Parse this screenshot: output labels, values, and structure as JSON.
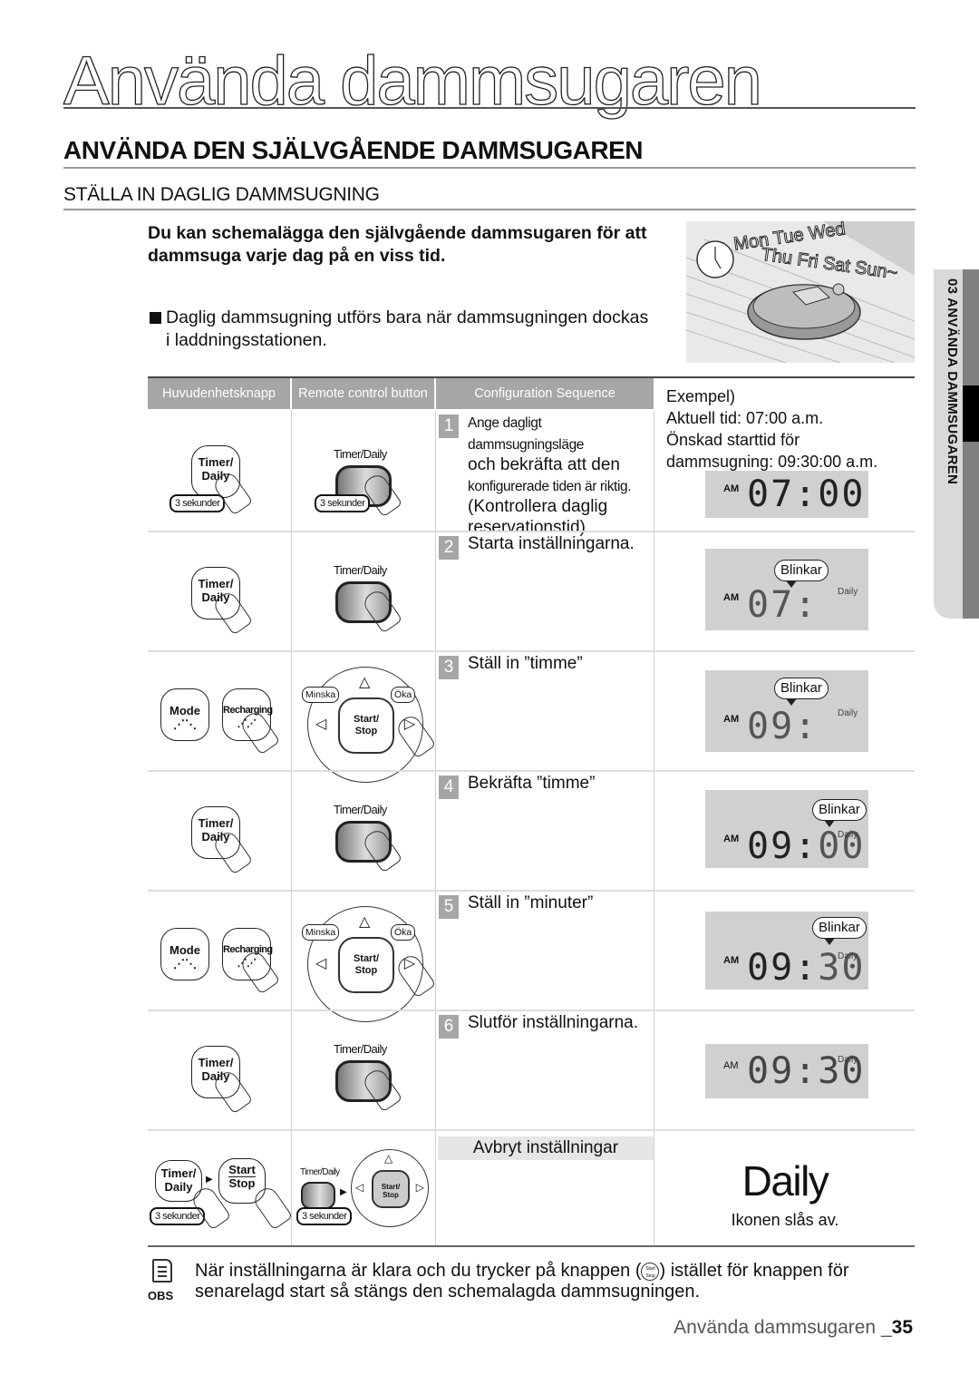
{
  "page": {
    "title": "Använda dammsugaren",
    "section_heading": "ANVÄNDA DEN SJÄLVGÅENDE DAMMSUGAREN",
    "subsection_heading": "STÄLLA IN DAGLIG DAMMSUGNING",
    "intro": "Du kan schemalägga den självgående dammsugaren för att dammsuga varje dag på en viss tid.",
    "bullet": "Daglig dammsugning utförs bara när dammsugningen dockas i laddningsstationen.",
    "side_tab": "03 ANVÄNDA DAMMSUGAREN"
  },
  "illustration": {
    "days_line1": "Mon Tue Wed",
    "days_line2": "Thu Fri Sat Sun~",
    "icons": [
      "alarm-clock",
      "robot-vacuum"
    ]
  },
  "table": {
    "headers": [
      "Huvudenhetsknapp",
      "Remote control button",
      "Configuration Sequence"
    ],
    "example": {
      "label": "Exempel)",
      "current": "Aktuell tid: 07:00 a.m.",
      "desired_1": "Önskad starttid för",
      "desired_2": "dammsugning: 09:30:00 a.m."
    },
    "buttons": {
      "timer_daily_unit_1": "Timer/",
      "timer_daily_unit_2": "Daily",
      "timer_daily_remote": "Timer/Daily",
      "three_seconds": "3 sekunder",
      "mode": "Mode",
      "recharging": "Recharging",
      "start_stop_1": "Start/",
      "start_stop_2": "Stop",
      "start": "Start",
      "stop": "Stop",
      "minska": "Minska",
      "oka": "Öka"
    },
    "steps": [
      {
        "num": "1",
        "text_small": "Ange dagligt dammsugningsläge",
        "text": "och bekräfta att den",
        "text_small2": "konfigurerade tiden är riktig.",
        "text2": "(Kontrollera daglig reservationstid)",
        "lcd": {
          "am": "AM",
          "hh": "07",
          "mm": "00",
          "daily": "",
          "blink": ""
        }
      },
      {
        "num": "2",
        "text": "Starta inställningarna.",
        "lcd": {
          "am": "AM",
          "hh": "07",
          "mm": "",
          "daily": "Daily",
          "blink": "Blinkar"
        }
      },
      {
        "num": "3",
        "text": "Ställ in ”timme”",
        "lcd": {
          "am": "AM",
          "hh": "09",
          "mm": "",
          "daily": "Daily",
          "blink": "Blinkar"
        }
      },
      {
        "num": "4",
        "text": "Bekräfta ”timme”",
        "lcd": {
          "am": "AM",
          "hh": "09",
          "mm": "00",
          "daily": "Daily",
          "blink": "Blinkar"
        }
      },
      {
        "num": "5",
        "text": "Ställ in ”minuter”",
        "lcd": {
          "am": "AM",
          "hh": "09",
          "mm": "30",
          "daily": "Daily",
          "blink": "Blinkar"
        }
      },
      {
        "num": "6",
        "text": "Slutför inställningarna.",
        "lcd": {
          "am": "AM",
          "hh": "09",
          "mm": "30",
          "daily": "Daily",
          "blink": ""
        }
      }
    ],
    "cancel": {
      "heading": "Avbryt inställningar",
      "icon_text": "Daily",
      "result": "Ikonen slås av."
    }
  },
  "note": {
    "label": "OBS",
    "text_before": "När inställningarna är klara och du trycker på knappen (",
    "btn_top": "Start",
    "btn_bottom": "Stop",
    "text_after": ") istället för knappen för senarelagd start så stängs den schemalagda dammsugningen."
  },
  "footer": {
    "text": "Använda dammsugaren _",
    "page": "35"
  }
}
